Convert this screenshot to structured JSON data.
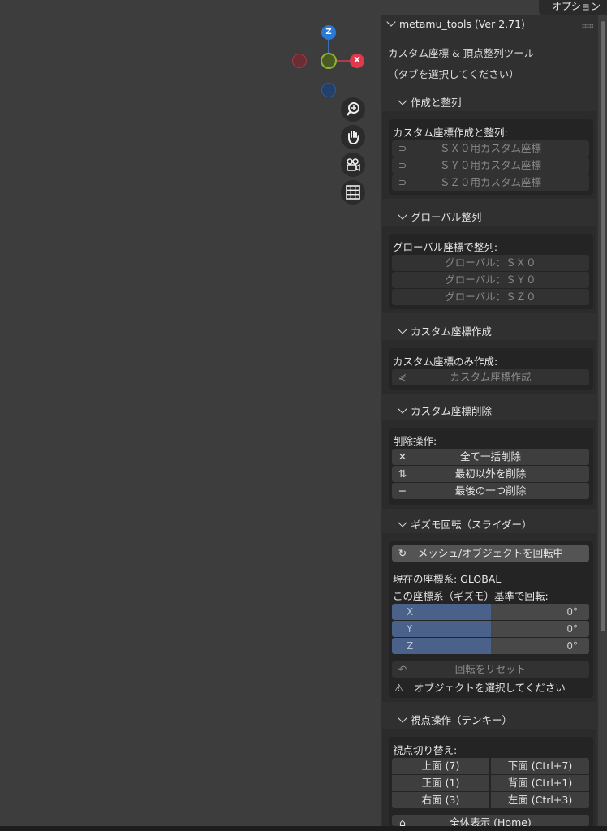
{
  "options_label": "オプション",
  "gizmo": {
    "z": "Z",
    "x": "X"
  },
  "nav_icons": [
    "zoom-icon",
    "hand-icon",
    "camera-icon",
    "grid-icon"
  ],
  "panel": {
    "header": "metamu_tools (Ver 2.71)",
    "note1": "カスタム座標 & 頂点整列ツール",
    "note2": "（タブを選択してください）"
  },
  "create_align": {
    "header": "作成と整列",
    "box_title": "カスタム座標作成と整列:",
    "buttons": [
      "ＳＸ０用カスタム座標",
      "ＳＹ０用カスタム座標",
      "ＳＺ０用カスタム座標"
    ]
  },
  "global_align": {
    "header": "グローバル整列",
    "box_title": "グローバル座標で整列:",
    "buttons": [
      "グローバル：ＳＸ０",
      "グローバル：ＳＹ０",
      "グローバル：ＳＺ０"
    ]
  },
  "custom_create": {
    "header": "カスタム座標作成",
    "box_title": "カスタム座標のみ作成:",
    "button": "カスタム座標作成"
  },
  "custom_delete": {
    "header": "カスタム座標削除",
    "box_title": "削除操作:",
    "buttons": [
      "全て一括削除",
      "最初以外を削除",
      "最後の一つ削除"
    ]
  },
  "gizmo_rotate": {
    "header": "ギズモ回転（スライダー）",
    "mode_button": "メッシュ/オブジェクトを回転中",
    "current_system": "現在の座標系: GLOBAL",
    "rotate_label": "この座標系（ギズモ）基準で回転:",
    "sliders": [
      {
        "axis": "X",
        "value": "0°",
        "fill": 0.5
      },
      {
        "axis": "Y",
        "value": "0°",
        "fill": 0.5
      },
      {
        "axis": "Z",
        "value": "0°",
        "fill": 0.5
      }
    ],
    "reset_button": "回転をリセット",
    "warning": "オブジェクトを選択してください"
  },
  "view_ops": {
    "header": "視点操作（テンキー）",
    "box_title": "視点切り替え:",
    "grid": [
      [
        "上面 (7)",
        "下面 (Ctrl+7)"
      ],
      [
        "正面 (1)",
        "背面 (Ctrl+1)"
      ],
      [
        "右面 (3)",
        "左面 (Ctrl+3)"
      ]
    ],
    "home_button": "全体表示 (Home)"
  },
  "colors": {
    "x_axis": "#e0394c",
    "y_axis": "#7ea02a",
    "z_axis": "#2b79d4",
    "slider_fill": "#4a6289"
  }
}
